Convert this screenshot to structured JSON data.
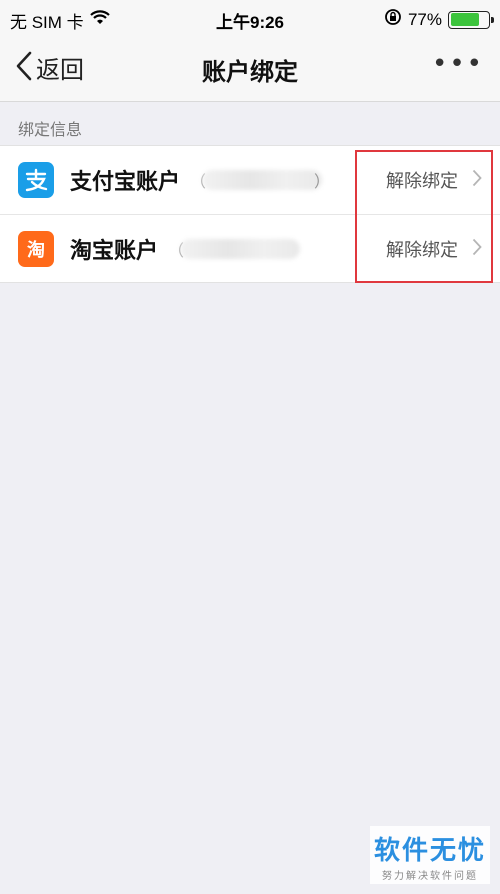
{
  "status_bar": {
    "carrier": "无 SIM 卡",
    "time": "上午9:26",
    "battery_percent": "77%",
    "battery_level": 0.77
  },
  "nav": {
    "back_label": "返回",
    "title": "账户绑定",
    "more_label": "•••"
  },
  "section": {
    "header": "绑定信息"
  },
  "accounts": [
    {
      "name": "支付宝账户",
      "id_prefix": "（",
      "id_suffix": "）",
      "action": "解除绑定",
      "icon": "alipay-icon"
    },
    {
      "name": "淘宝账户",
      "id_prefix": "（",
      "id_suffix": "",
      "action": "解除绑定",
      "icon": "taobao-icon"
    }
  ],
  "watermark": {
    "title": "软件无忧",
    "subtitle": "努力解决软件问题"
  },
  "colors": {
    "alipay": "#1a9ee8",
    "taobao": "#ff6a1a",
    "highlight": "#e0383e",
    "battery": "#3cc43c"
  }
}
